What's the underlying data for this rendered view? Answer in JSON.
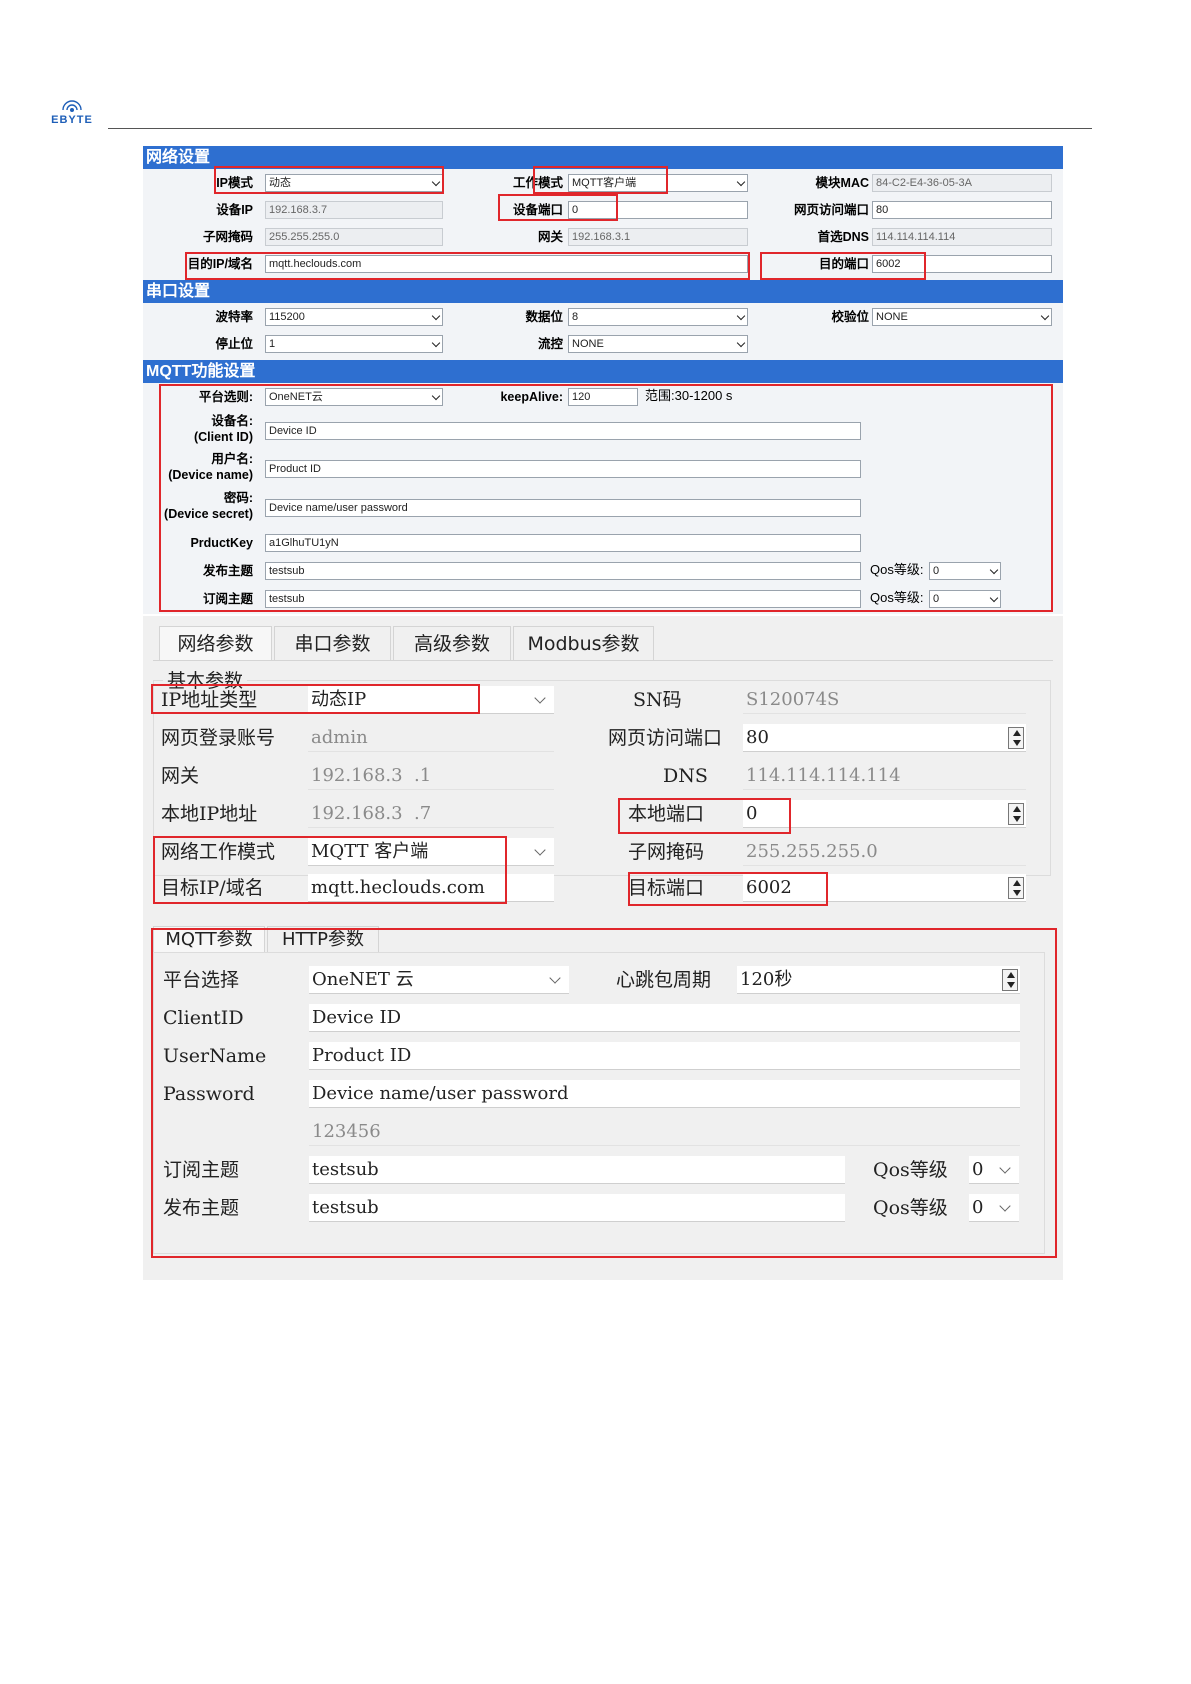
{
  "header": {
    "logo_text": "EBYTE"
  },
  "web": {
    "network": {
      "title": "网络设置",
      "ip_mode": {
        "label": "IP模式",
        "value": "动态"
      },
      "work_mode": {
        "label": "工作模式",
        "value": "MQTT客户端"
      },
      "mac": {
        "label": "模块MAC",
        "value": "84-C2-E4-36-05-3A"
      },
      "device_ip": {
        "label": "设备IP",
        "value": "192.168.3.7"
      },
      "device_port": {
        "label": "设备端口",
        "value": "0"
      },
      "web_port": {
        "label": "网页访问端口",
        "value": "80"
      },
      "subnet": {
        "label": "子网掩码",
        "value": "255.255.255.0"
      },
      "gateway": {
        "label": "网关",
        "value": "192.168.3.1"
      },
      "dns": {
        "label": "首选DNS",
        "value": "114.114.114.114"
      },
      "target_host": {
        "label": "目的IP/域名",
        "value": "mqtt.heclouds.com"
      },
      "target_port": {
        "label": "目的端口",
        "value": "6002"
      }
    },
    "serial": {
      "title": "串口设置",
      "baud": {
        "label": "波特率",
        "value": "115200"
      },
      "databits": {
        "label": "数据位",
        "value": "8"
      },
      "parity": {
        "label": "校验位",
        "value": "NONE"
      },
      "stopbits": {
        "label": "停止位",
        "value": "1"
      },
      "flow": {
        "label": "流控",
        "value": "NONE"
      }
    },
    "mqtt": {
      "title": "MQTT功能设置",
      "platform": {
        "label": "平台选则:",
        "value": "OneNET云"
      },
      "keepalive": {
        "label": "keepAlive:",
        "value": "120",
        "range": "范围:30-1200 s"
      },
      "client_id": {
        "label1": "设备名:",
        "label2": "(Client ID)",
        "value": "Device ID"
      },
      "device_name": {
        "label1": "用户名:",
        "label2": "(Device name)",
        "value": "Product ID"
      },
      "device_secret": {
        "label1": "密码:",
        "label2": "(Device secret)",
        "value": "Device name/user password"
      },
      "product_key": {
        "label": "PrductKey",
        "value": "a1GlhuTU1yN"
      },
      "publish": {
        "label": "发布主题",
        "value": "testsub",
        "qos_label": "Qos等级:",
        "qos": "0"
      },
      "subscribe": {
        "label": "订阅主题",
        "value": "testsub",
        "qos_label": "Qos等级:",
        "qos": "0"
      }
    }
  },
  "app": {
    "tabs": [
      "网络参数",
      "串口参数",
      "高级参数",
      "Modbus参数"
    ],
    "basic_title": "基本参数",
    "ip_type": {
      "label": "IP地址类型",
      "value": "动态IP"
    },
    "sn": {
      "label": "SN码",
      "value": "S120074S"
    },
    "login": {
      "label": "网页登录账号",
      "value": "admin"
    },
    "web_port": {
      "label": "网页访问端口",
      "value": "80"
    },
    "gateway": {
      "label": "网关",
      "value": "192.168.3  .1"
    },
    "dns": {
      "label": "DNS",
      "value": "114.114.114.114"
    },
    "local_ip": {
      "label": "本地IP地址",
      "value": "192.168.3  .7"
    },
    "local_port": {
      "label": "本地端口",
      "value": "0"
    },
    "net_mode": {
      "label": "网络工作模式",
      "value": "MQTT 客户端"
    },
    "subnet": {
      "label": "子网掩码",
      "value": "255.255.255.0"
    },
    "target_host": {
      "label": "目标IP/域名",
      "value": "mqtt.heclouds.com"
    },
    "target_port": {
      "label": "目标端口",
      "value": "6002"
    },
    "subtabs": [
      "MQTT参数",
      "HTTP参数"
    ],
    "platform": {
      "label": "平台选择",
      "value": "OneNET 云"
    },
    "heartbeat": {
      "label": "心跳包周期",
      "value": "120秒"
    },
    "client_id": {
      "label": "ClientID",
      "value": "Device ID"
    },
    "username": {
      "label": "UserName",
      "value": "Product ID"
    },
    "password": {
      "label": "Password",
      "value": "Device name/user password",
      "extra": "123456"
    },
    "subscribe": {
      "label": "订阅主题",
      "value": "testsub",
      "qos_label": "Qos等级",
      "qos": "0"
    },
    "publish": {
      "label": "发布主题",
      "value": "testsub",
      "qos_label": "Qos等级",
      "qos": "0"
    }
  }
}
